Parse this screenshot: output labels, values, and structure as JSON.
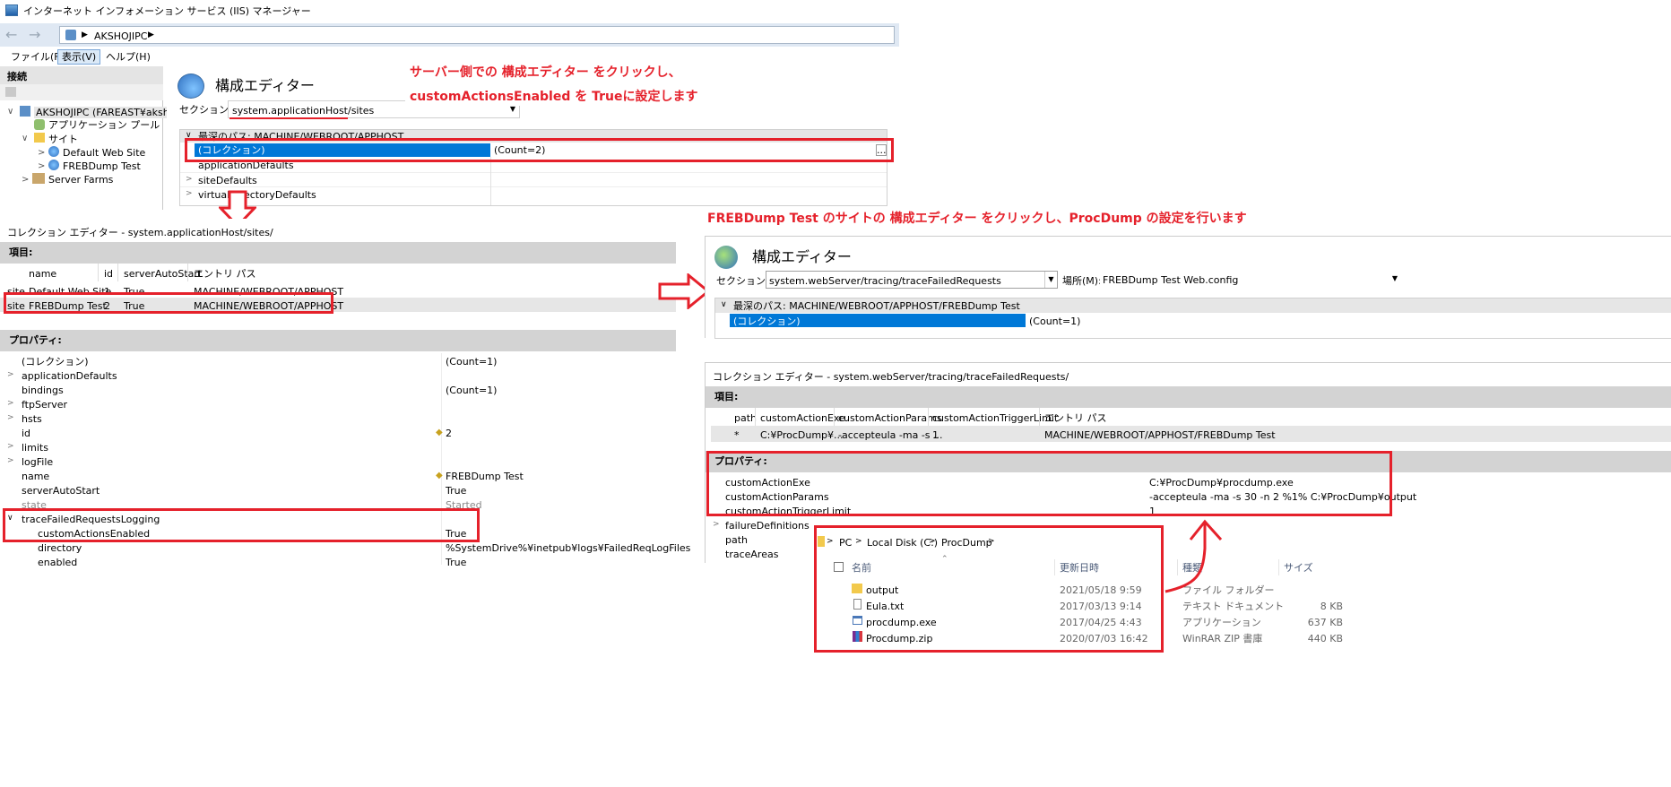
{
  "window": {
    "title": "インターネット インフォメーション サービス (IIS) マネージャー",
    "address": "AKSHOJIPC",
    "menu": [
      "ファイル(F)",
      "表示(V)",
      "ヘルプ(H)"
    ]
  },
  "connections": {
    "header": "接続",
    "tree": [
      {
        "label": "AKSHOJIPC (FAREAST¥akshoji)"
      },
      {
        "label": "アプリケーション プール"
      },
      {
        "label": "サイト"
      },
      {
        "label": "Default Web Site"
      },
      {
        "label": "FREBDump Test"
      },
      {
        "label": "Server Farms"
      }
    ]
  },
  "config_editor_top": {
    "title": "構成エディター",
    "section_label": "セクション(S):",
    "section_value": "system.applicationHost/sites",
    "deepest_path": "最深のパス: MACHINE/WEBROOT/APPHOST",
    "rows": [
      {
        "name": "(コレクション)",
        "value": "(Count=2)"
      },
      {
        "name": "applicationDefaults",
        "value": ""
      },
      {
        "name": "siteDefaults",
        "value": ""
      },
      {
        "name": "virtualDirectoryDefaults",
        "value": ""
      }
    ],
    "ellipsis": "..."
  },
  "annotations": {
    "top_line1": "サーバー側での 構成エディター をクリックし、",
    "top_line2": "customActionsEnabled を Trueに設定します",
    "right": "FREBDump Test のサイトの 構成エディター をクリックし、ProcDump の設定を行います"
  },
  "collection_editor_left": {
    "title": "コレクション エディター - system.applicationHost/sites/",
    "items_header": "項目:",
    "columns": [
      "name",
      "id",
      "serverAutoStart",
      "エントリ パス"
    ],
    "rows": [
      {
        "prefix": "site",
        "name": "Default Web Site",
        "id": "1",
        "auto": "True",
        "path": "MACHINE/WEBROOT/APPHOST"
      },
      {
        "prefix": "site",
        "name": "FREBDump Test",
        "id": "2",
        "auto": "True",
        "path": "MACHINE/WEBROOT/APPHOST"
      }
    ],
    "props_header": "プロパティ:",
    "props": [
      {
        "name": "(コレクション)",
        "value": "(Count=1)"
      },
      {
        "name": "applicationDefaults",
        "value": ""
      },
      {
        "name": "bindings",
        "value": "(Count=1)"
      },
      {
        "name": "ftpServer",
        "value": ""
      },
      {
        "name": "hsts",
        "value": ""
      },
      {
        "name": "id",
        "value": "2"
      },
      {
        "name": "limits",
        "value": ""
      },
      {
        "name": "logFile",
        "value": ""
      },
      {
        "name": "name",
        "value": "FREBDump Test"
      },
      {
        "name": "serverAutoStart",
        "value": "True"
      },
      {
        "name": "state",
        "value": "Started"
      },
      {
        "name": "traceFailedRequestsLogging",
        "value": ""
      },
      {
        "name": "customActionsEnabled",
        "value": "True"
      },
      {
        "name": "directory",
        "value": "%SystemDrive%¥inetpub¥logs¥FailedReqLogFiles"
      },
      {
        "name": "enabled",
        "value": "True"
      }
    ]
  },
  "config_editor_right": {
    "title": "構成エディター",
    "section_label": "セクション(S):",
    "section_value": "system.webServer/tracing/traceFailedRequests",
    "location_label": "場所(M):",
    "location_value": "FREBDump Test Web.config",
    "deepest_path": "最深のパス: MACHINE/WEBROOT/APPHOST/FREBDump Test",
    "row_name": "(コレクション)",
    "row_value": "(Count=1)"
  },
  "collection_editor_right": {
    "title": "コレクション エディター - system.webServer/tracing/traceFailedRequests/",
    "items_header": "項目:",
    "columns": [
      "path",
      "customActionExe",
      "customActionParams",
      "customActionTriggerLimit",
      "エントリ パス"
    ],
    "row": {
      "path": "*",
      "exe": "C:¥ProcDump¥...",
      "params": "-accepteula -ma -s ...",
      "limit": "1",
      "entry": "MACHINE/WEBROOT/APPHOST/FREBDump Test"
    },
    "props_header": "プロパティ:",
    "props": [
      {
        "name": "customActionExe",
        "value": "C:¥ProcDump¥procdump.exe"
      },
      {
        "name": "customActionParams",
        "value": "-accepteula -ma -s 30 -n 2 %1% C:¥ProcDump¥output"
      },
      {
        "name": "customActionTriggerLimit",
        "value": "1"
      },
      {
        "name": "failureDefinitions",
        "value": ""
      },
      {
        "name": "path",
        "value": ""
      },
      {
        "name": "traceAreas",
        "value": ""
      }
    ]
  },
  "explorer": {
    "breadcrumb": [
      "PC",
      "Local Disk (C:)",
      "ProcDump"
    ],
    "columns": [
      "名前",
      "更新日時",
      "種類",
      "サイズ"
    ],
    "files": [
      {
        "name": "output",
        "date": "2021/05/18 9:59",
        "type": "ファイル フォルダー",
        "size": ""
      },
      {
        "name": "Eula.txt",
        "date": "2017/03/13 9:14",
        "type": "テキスト ドキュメント",
        "size": "8 KB"
      },
      {
        "name": "procdump.exe",
        "date": "2017/04/25 4:43",
        "type": "アプリケーション",
        "size": "637 KB"
      },
      {
        "name": "Procdump.zip",
        "date": "2020/07/03 16:42",
        "type": "WinRAR ZIP 書庫",
        "size": "440 KB"
      }
    ]
  },
  "colors": {
    "annotation_red": "#e5212b",
    "selection_blue": "#0078d7",
    "header_grey": "#d3d3d3"
  }
}
